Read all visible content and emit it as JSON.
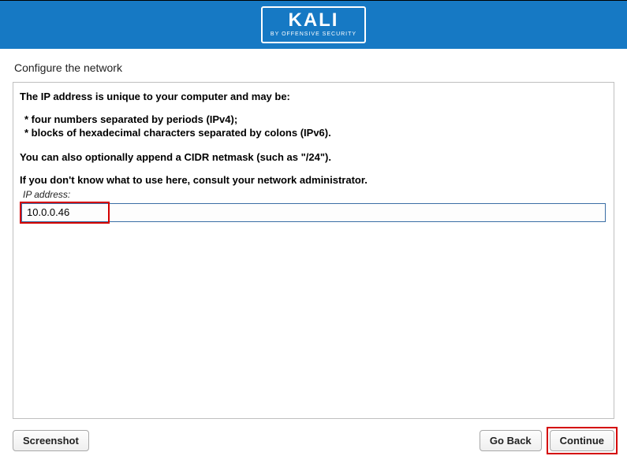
{
  "header": {
    "logo_text": "KALI",
    "logo_sub": "BY OFFENSIVE SECURITY"
  },
  "page": {
    "title": "Configure the network"
  },
  "content": {
    "intro": "The IP address is unique to your computer and may be:",
    "bullet1": "* four numbers separated by periods (IPv4);",
    "bullet2": "* blocks of hexadecimal characters separated by colons (IPv6).",
    "cidr": "You can also optionally append a CIDR netmask (such as \"/24\").",
    "consult": "If you don't know what to use here, consult your network administrator.",
    "field_label": "IP address:",
    "ip_value": "10.0.0.46"
  },
  "footer": {
    "screenshot": "Screenshot",
    "go_back": "Go Back",
    "continue": "Continue"
  }
}
